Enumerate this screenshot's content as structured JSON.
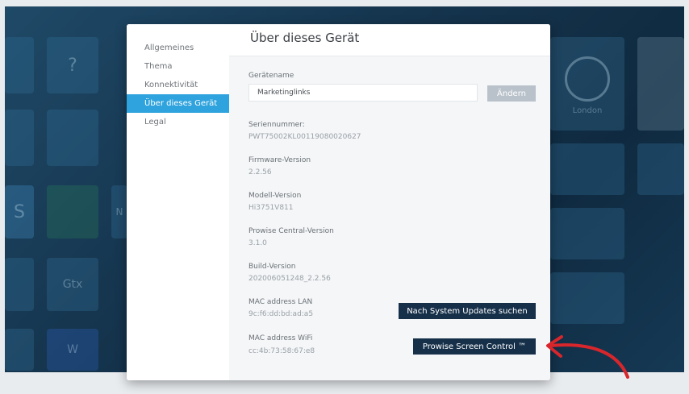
{
  "dialog": {
    "title": "Über dieses Gerät",
    "sidebar": {
      "items": [
        {
          "label": "Allgemeines"
        },
        {
          "label": "Thema"
        },
        {
          "label": "Konnektivität"
        },
        {
          "label": "Über dieses Gerät",
          "active": true
        },
        {
          "label": "Legal"
        }
      ]
    },
    "device_name": {
      "label": "Gerätename",
      "value": "Marketinglinks",
      "button": "Ändern"
    },
    "serial": {
      "label": "Seriennummer:",
      "value": "PWT75002KL00119080020627"
    },
    "firmware": {
      "label": "Firmware-Version",
      "value": "2.2.56"
    },
    "model": {
      "label": "Modell-Version",
      "value": "Hi3751V811"
    },
    "prowise_central": {
      "label": "Prowise Central-Version",
      "value": "3.1.0"
    },
    "build": {
      "label": "Build-Version",
      "value": "202006051248_2.2.56"
    },
    "mac_lan": {
      "label": "MAC address LAN",
      "value": "9c:f6:dd:bd:ad:a5"
    },
    "mac_wifi": {
      "label": "MAC address WiFi",
      "value": "cc:4b:73:58:67:e8"
    },
    "buttons": {
      "updates": "Nach System Updates suchen",
      "screen_control": "Prowise Screen Control ™"
    }
  },
  "background": {
    "clock_label": "London",
    "tile_labels": [
      "?",
      "S",
      "N",
      "Gtx",
      "W"
    ]
  },
  "colors": {
    "active_nav": "#2fa3dd",
    "dark_button": "#16304a",
    "disabled_button": "#b9c2cb",
    "arrow": "#d7262c"
  }
}
